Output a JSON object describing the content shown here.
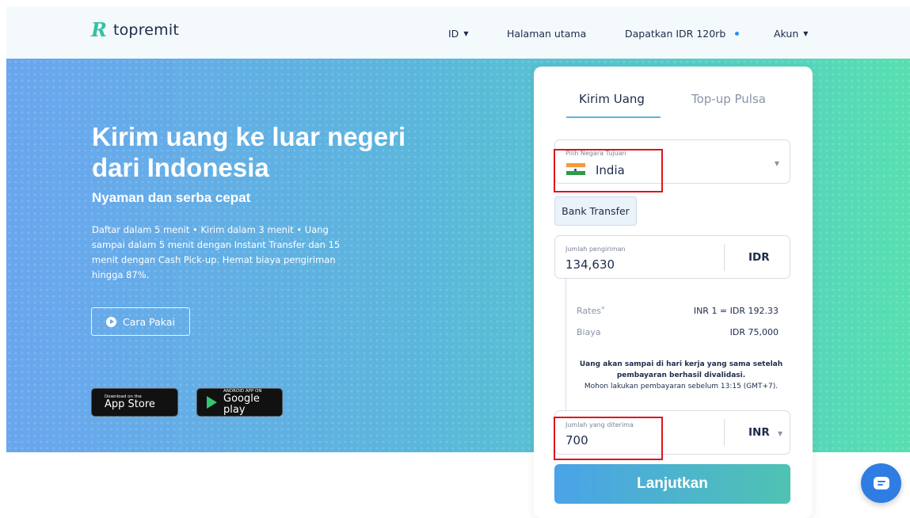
{
  "brand": {
    "mark": "R",
    "name": "topremit"
  },
  "nav": {
    "language": "ID",
    "home": "Halaman utama",
    "referral": "Dapatkan IDR 120rb",
    "account": "Akun"
  },
  "hero": {
    "headline": "Kirim uang ke luar negeri dari Indonesia",
    "subheadline": "Nyaman dan serba cepat",
    "description": "Daftar dalam 5 menit • Kirim dalam 3 menit • Uang sampai dalam 5 menit dengan Instant Transfer dan 15 menit dengan Cash Pick-up. Hemat biaya pengiriman hingga 87%.",
    "how_to_button": "Cara Pakai",
    "app_store": {
      "small": "Download on the",
      "big": "App Store"
    },
    "google_play": {
      "small": "ANDROID APP ON",
      "big": "Google play"
    }
  },
  "form": {
    "tabs": [
      "Kirim Uang",
      "Top-up Pulsa"
    ],
    "active_tab": "Kirim Uang",
    "country_label": "Pilih Negara Tujuan",
    "country_value": "India",
    "method": "Bank Transfer",
    "send_label": "Jumlah pengiriman",
    "send_amount": "134,630",
    "send_currency": "IDR",
    "rates_label": "Rates",
    "rates_value": "INR 1 = IDR 192.33",
    "fee_label": "Biaya",
    "fee_value": "IDR 75,000",
    "note_bold": "Uang akan sampai di hari kerja yang sama setelah pembayaran berhasil divalidasi.",
    "note_normal": "Mohon lakukan pembayaran sebelum 13:15 (GMT+7).",
    "receive_label": "Jumlah yang diterima",
    "receive_amount": "700",
    "receive_currency": "INR",
    "submit": "Lanjutkan"
  },
  "colors": {
    "accent": "#36c0a3",
    "highlight": "#e0141c",
    "chat": "#2f7de3"
  },
  "icons": [
    "chevron-down-icon",
    "play-icon",
    "apple-icon",
    "google-play-icon",
    "india-flag-icon",
    "chat-icon"
  ]
}
